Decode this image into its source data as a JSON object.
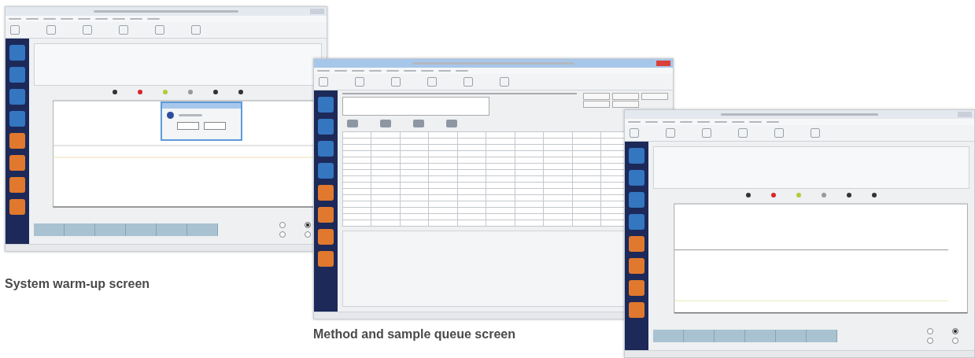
{
  "screenshots": [
    {
      "kind": "warmup",
      "caption": "System warm-up screen",
      "options": [
        {
          "selected": false
        },
        {
          "selected": true
        },
        {
          "selected": false
        },
        {
          "selected": false
        }
      ]
    },
    {
      "kind": "queue",
      "caption": "Method and sample queue screen"
    },
    {
      "kind": "monitor",
      "options": [
        {
          "selected": false
        },
        {
          "selected": true
        },
        {
          "selected": false
        },
        {
          "selected": false
        }
      ]
    }
  ]
}
